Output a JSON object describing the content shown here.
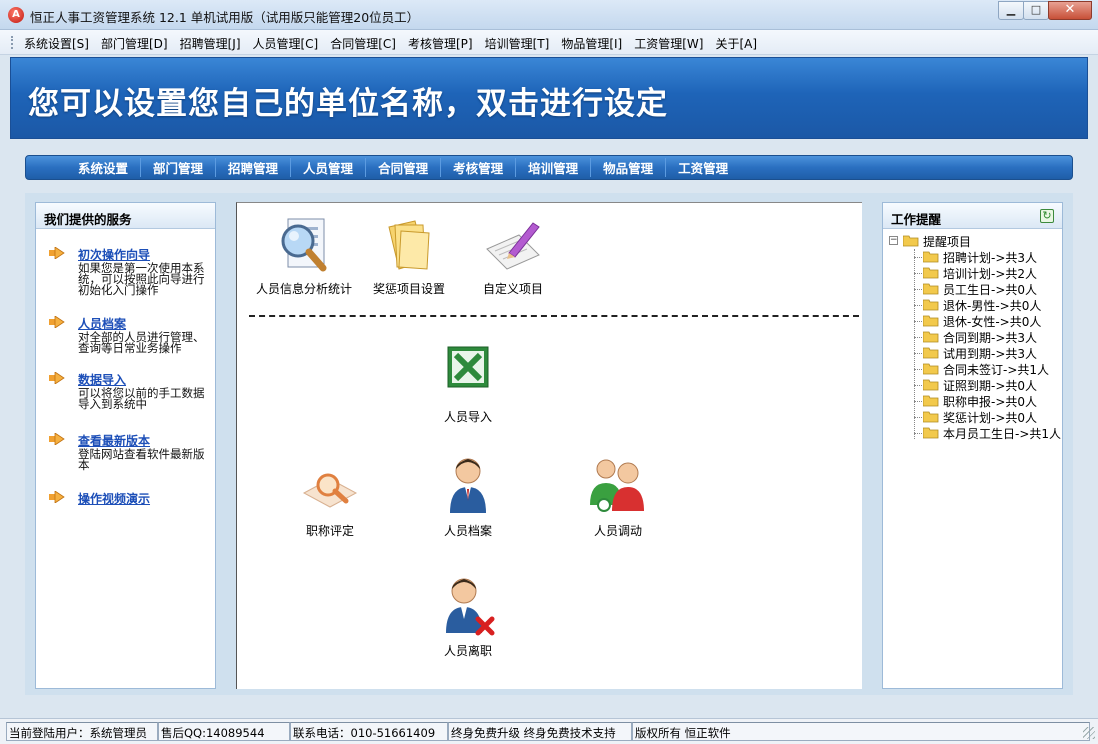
{
  "window": {
    "title": "恒正人事工资管理系统 12.1 单机试用版（试用版只能管理20位员工）",
    "app_icon_glyph": "A",
    "minimize_glyph": "▁",
    "maximize_glyph": "□",
    "close_glyph": "✕"
  },
  "menu": {
    "items": [
      {
        "label": "系统设置[S]"
      },
      {
        "label": "部门管理[D]"
      },
      {
        "label": "招聘管理[J]"
      },
      {
        "label": "人员管理[C]"
      },
      {
        "label": "合同管理[C]"
      },
      {
        "label": "考核管理[P]"
      },
      {
        "label": "培训管理[T]"
      },
      {
        "label": "物品管理[I]"
      },
      {
        "label": "工资管理[W]"
      },
      {
        "label": "关于[A]"
      }
    ]
  },
  "banner": {
    "title": "您可以设置您自己的单位名称，双击进行设定"
  },
  "nav": {
    "items": [
      {
        "label": "系统设置"
      },
      {
        "label": "部门管理"
      },
      {
        "label": "招聘管理"
      },
      {
        "label": "人员管理"
      },
      {
        "label": "合同管理"
      },
      {
        "label": "考核管理"
      },
      {
        "label": "培训管理"
      },
      {
        "label": "物品管理"
      },
      {
        "label": "工资管理"
      }
    ]
  },
  "services": {
    "header": "我们提供的服务",
    "items": [
      {
        "title": "初次操作向导",
        "desc": "如果您是第一次使用本系统，可以按照此向导进行初始化入门操作"
      },
      {
        "title": "人员档案",
        "desc": "对全部的人员进行管理、查询等日常业务操作"
      },
      {
        "title": "数据导入",
        "desc": "可以将您以前的手工数据导入到系统中"
      },
      {
        "title": "查看最新版本",
        "desc": "登陆网站查看软件最新版本"
      },
      {
        "title": "操作视频演示",
        "desc": ""
      }
    ]
  },
  "tiles": {
    "analysis": "人员信息分析统计",
    "reward": "奖惩项目设置",
    "custom": "自定义项目",
    "import": "人员导入",
    "title_eval": "职称评定",
    "archive": "人员档案",
    "transfer": "人员调动",
    "resign": "人员离职"
  },
  "reminders": {
    "header": "工作提醒",
    "root_label": "提醒项目",
    "expander_glyph": "−",
    "refresh_glyph": "↻",
    "items": [
      {
        "label": "招聘计划->共3人"
      },
      {
        "label": "培训计划->共2人"
      },
      {
        "label": "员工生日->共0人"
      },
      {
        "label": "退休-男性->共0人"
      },
      {
        "label": "退休-女性->共0人"
      },
      {
        "label": "合同到期->共3人"
      },
      {
        "label": "试用到期->共3人"
      },
      {
        "label": "合同未签订->共1人"
      },
      {
        "label": "证照到期->共0人"
      },
      {
        "label": "职称申报->共0人"
      },
      {
        "label": "奖惩计划->共0人"
      },
      {
        "label": "本月员工生日->共1人"
      }
    ]
  },
  "status": {
    "user": "当前登陆用户：系统管理员",
    "qq": "售后QQ:14089544",
    "phone": "联系电话：010-51661409",
    "support": "终身免费升级 终身免费技术支持",
    "copyright": "版权所有 恒正软件"
  },
  "colors": {
    "banner_blue": "#1e64b8",
    "link_blue": "#1d4fb8",
    "folder_yellow": "#f2c94c"
  }
}
